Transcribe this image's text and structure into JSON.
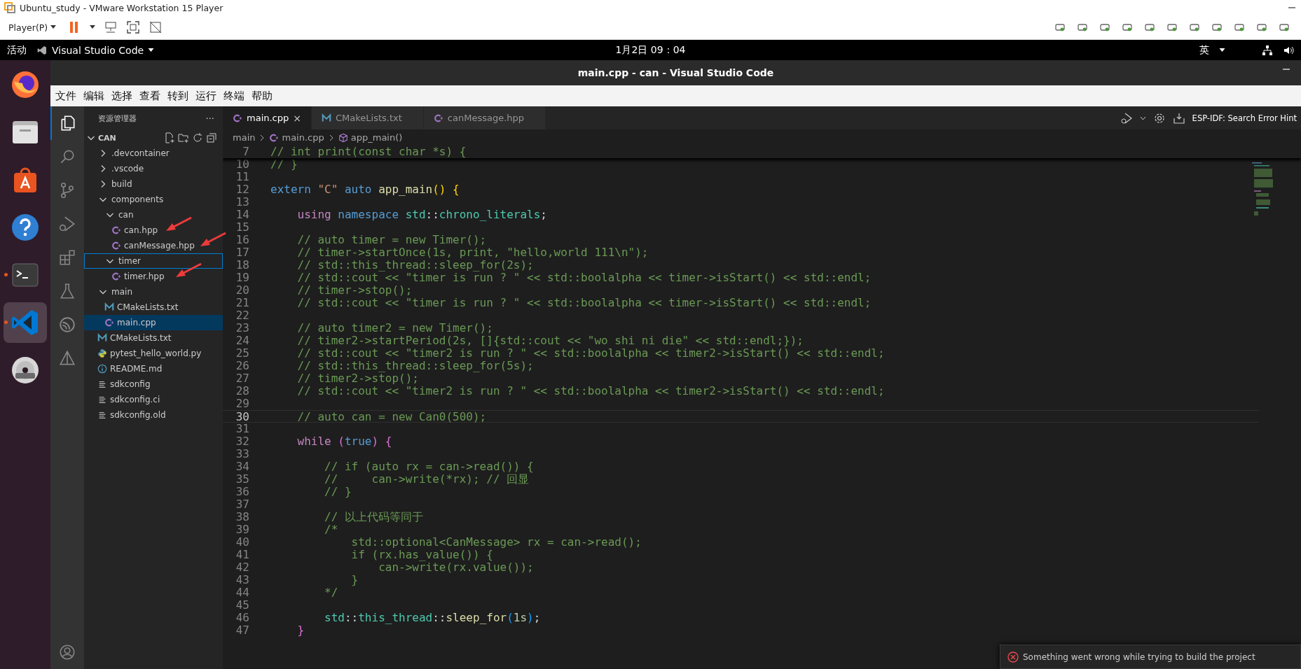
{
  "vm_window": {
    "title": "Ubuntu_study - VMware Workstation 15 Player",
    "player_menu": "Player(P)"
  },
  "top_bar": {
    "activities": "活动",
    "app_menu": "Visual Studio Code",
    "clock": "1月2日  09：04",
    "input_method": "英"
  },
  "dock": [
    {
      "kind": "firefox",
      "running": false,
      "selected": false
    },
    {
      "kind": "files",
      "running": false,
      "selected": false
    },
    {
      "kind": "store",
      "running": false,
      "selected": false
    },
    {
      "kind": "help",
      "running": false,
      "selected": false
    },
    {
      "kind": "terminal",
      "running": true,
      "selected": false
    },
    {
      "kind": "vscode",
      "running": true,
      "selected": true
    },
    {
      "kind": "dvd",
      "running": false,
      "selected": false
    }
  ],
  "window": {
    "title": "main.cpp - can - Visual Studio Code"
  },
  "menu": [
    "文件",
    "编辑",
    "选择",
    "查看",
    "转到",
    "运行",
    "终端",
    "帮助"
  ],
  "sidebar": {
    "title": "资源管理器",
    "more": "···",
    "root": {
      "label": "CAN",
      "expanded": true
    },
    "items": [
      {
        "label": ".devcontainer",
        "kind": "folder",
        "expanded": false,
        "selected": false,
        "focused": false,
        "annotated": false
      },
      {
        "label": ".vscode",
        "kind": "folder",
        "expanded": false,
        "selected": false,
        "focused": false,
        "annotated": false
      },
      {
        "label": "build",
        "kind": "folder",
        "expanded": false,
        "selected": false,
        "focused": false,
        "annotated": false
      },
      {
        "label": "components",
        "kind": "folder",
        "expanded": true,
        "selected": false,
        "focused": false,
        "annotated": false,
        "children": [
          {
            "label": "can",
            "kind": "folder",
            "expanded": true,
            "selected": false,
            "focused": false,
            "annotated": false,
            "children": [
              {
                "label": "can.hpp",
                "kind": "cpp",
                "selected": false,
                "focused": false,
                "annotated": true
              },
              {
                "label": "canMessage.hpp",
                "kind": "cpp",
                "selected": false,
                "focused": false,
                "annotated": true
              }
            ]
          },
          {
            "label": "timer",
            "kind": "folder",
            "expanded": true,
            "selected": false,
            "focused": true,
            "annotated": false,
            "children": [
              {
                "label": "timer.hpp",
                "kind": "cpp",
                "selected": false,
                "focused": false,
                "annotated": true
              }
            ]
          }
        ]
      },
      {
        "label": "main",
        "kind": "folder",
        "expanded": true,
        "selected": false,
        "focused": false,
        "annotated": false,
        "children": [
          {
            "label": "CMakeLists.txt",
            "kind": "cmake",
            "selected": false,
            "focused": false,
            "annotated": false
          },
          {
            "label": "main.cpp",
            "kind": "cpp",
            "selected": true,
            "focused": false,
            "annotated": false
          }
        ]
      },
      {
        "label": "CMakeLists.txt",
        "kind": "cmake",
        "selected": false,
        "focused": false,
        "annotated": false
      },
      {
        "label": "pytest_hello_world.py",
        "kind": "python",
        "selected": false,
        "focused": false,
        "annotated": false
      },
      {
        "label": "README.md",
        "kind": "info",
        "selected": false,
        "focused": false,
        "annotated": false
      },
      {
        "label": "sdkconfig",
        "kind": "config",
        "selected": false,
        "focused": false,
        "annotated": false
      },
      {
        "label": "sdkconfig.ci",
        "kind": "config",
        "selected": false,
        "focused": false,
        "annotated": false
      },
      {
        "label": "sdkconfig.old",
        "kind": "config",
        "selected": false,
        "focused": false,
        "annotated": false
      }
    ]
  },
  "tabs": [
    {
      "label": "main.cpp",
      "kind": "cpp",
      "selected": true,
      "close": "×"
    },
    {
      "label": "CMakeLists.txt",
      "kind": "cmake",
      "selected": false
    },
    {
      "label": "canMessage.hpp",
      "kind": "cpp",
      "selected": false
    }
  ],
  "editor_actions": {
    "hint": "ESP-IDF: Search Error Hint"
  },
  "breadcrumbs": [
    {
      "label": "main",
      "kind": "folder"
    },
    {
      "label": "main.cpp",
      "kind": "cpp"
    },
    {
      "label": "app_main()",
      "kind": "function"
    }
  ],
  "sticky_line": {
    "number": "7",
    "tokens": [
      {
        "text": "// int print(const char *s) {",
        "kind": "comment"
      }
    ]
  },
  "lines": [
    {
      "number": "10",
      "current": false,
      "tokens": [
        {
          "text": "// }",
          "kind": "comment"
        }
      ]
    },
    {
      "number": "11",
      "current": false
    },
    {
      "number": "12",
      "current": false,
      "tokens": [
        {
          "text": "extern",
          "kind": "keyword"
        },
        {
          "text": " \"C\"",
          "kind": "string"
        },
        {
          "text": " auto",
          "kind": "keyword"
        },
        {
          "text": " app_main",
          "kind": "func"
        },
        {
          "text": "()",
          "kind": "b1"
        },
        {
          "text": " {",
          "kind": "b1"
        }
      ]
    },
    {
      "number": "13",
      "current": false
    },
    {
      "number": "14",
      "current": false,
      "tokens": [
        {
          "text": "    using",
          "kind": "control"
        },
        {
          "text": " namespace",
          "kind": "keyword"
        },
        {
          "text": " std",
          "kind": "type"
        },
        {
          "text": "::",
          "kind": "plain"
        },
        {
          "text": "chrono_literals",
          "kind": "type"
        },
        {
          "text": ";",
          "kind": "plain"
        }
      ]
    },
    {
      "number": "15",
      "current": false
    },
    {
      "number": "16",
      "current": false,
      "tokens": [
        {
          "text": "    // auto timer = new Timer();",
          "kind": "comment"
        }
      ]
    },
    {
      "number": "17",
      "current": false,
      "tokens": [
        {
          "text": "    // timer->startOnce(1s, print, \"hello,world 111\\n\");",
          "kind": "comment"
        }
      ]
    },
    {
      "number": "18",
      "current": false,
      "tokens": [
        {
          "text": "    // std::this_thread::sleep_for(2s);",
          "kind": "comment"
        }
      ]
    },
    {
      "number": "19",
      "current": false,
      "tokens": [
        {
          "text": "    // std::cout << \"timer is run ? \" << std::boolalpha << timer->isStart() << std::endl;",
          "kind": "comment"
        }
      ]
    },
    {
      "number": "20",
      "current": false,
      "tokens": [
        {
          "text": "    // timer->stop();",
          "kind": "comment"
        }
      ]
    },
    {
      "number": "21",
      "current": false,
      "tokens": [
        {
          "text": "    // std::cout << \"timer is run ? \" << std::boolalpha << timer->isStart() << std::endl;",
          "kind": "comment"
        }
      ]
    },
    {
      "number": "22",
      "current": false
    },
    {
      "number": "23",
      "current": false,
      "tokens": [
        {
          "text": "    // auto timer2 = new Timer();",
          "kind": "comment"
        }
      ]
    },
    {
      "number": "24",
      "current": false,
      "tokens": [
        {
          "text": "    // timer2->startPeriod(2s, []{std::cout << \"wo shi ni die\" << std::endl;});",
          "kind": "comment"
        }
      ]
    },
    {
      "number": "25",
      "current": false,
      "tokens": [
        {
          "text": "    // std::cout << \"timer2 is run ? \" << std::boolalpha << timer2->isStart() << std::endl;",
          "kind": "comment"
        }
      ]
    },
    {
      "number": "26",
      "current": false,
      "tokens": [
        {
          "text": "    // std::this_thread::sleep_for(5s);",
          "kind": "comment"
        }
      ]
    },
    {
      "number": "27",
      "current": false,
      "tokens": [
        {
          "text": "    // timer2->stop();",
          "kind": "comment"
        }
      ]
    },
    {
      "number": "28",
      "current": false,
      "tokens": [
        {
          "text": "    // std::cout << \"timer2 is run ? \" << std::boolalpha << timer2->isStart() << std::endl;",
          "kind": "comment"
        }
      ]
    },
    {
      "number": "29",
      "current": false
    },
    {
      "number": "30",
      "current": true,
      "tokens": [
        {
          "text": "    // auto can = new Can0(500);",
          "kind": "comment"
        }
      ]
    },
    {
      "number": "31",
      "current": false
    },
    {
      "number": "32",
      "current": false,
      "tokens": [
        {
          "text": "    while",
          "kind": "control"
        },
        {
          "text": " (",
          "kind": "b2"
        },
        {
          "text": "true",
          "kind": "keyword"
        },
        {
          "text": ")",
          "kind": "b2"
        },
        {
          "text": " {",
          "kind": "b2"
        }
      ]
    },
    {
      "number": "33",
      "current": false
    },
    {
      "number": "34",
      "current": false,
      "tokens": [
        {
          "text": "        // if (auto rx = can->read()) {",
          "kind": "comment"
        }
      ]
    },
    {
      "number": "35",
      "current": false,
      "tokens": [
        {
          "text": "        //     can->write(*rx); // 回显",
          "kind": "comment"
        }
      ]
    },
    {
      "number": "36",
      "current": false,
      "tokens": [
        {
          "text": "        // }",
          "kind": "comment"
        }
      ]
    },
    {
      "number": "37",
      "current": false
    },
    {
      "number": "38",
      "current": false,
      "tokens": [
        {
          "text": "        // 以上代码等同于",
          "kind": "comment"
        }
      ]
    },
    {
      "number": "39",
      "current": false,
      "tokens": [
        {
          "text": "        /*",
          "kind": "comment"
        }
      ]
    },
    {
      "number": "40",
      "current": false,
      "tokens": [
        {
          "text": "            std::optional<CanMessage> rx = can->read();",
          "kind": "comment"
        }
      ]
    },
    {
      "number": "41",
      "current": false,
      "tokens": [
        {
          "text": "            if (rx.has_value()) {",
          "kind": "comment"
        }
      ]
    },
    {
      "number": "42",
      "current": false,
      "tokens": [
        {
          "text": "                can->write(rx.value());",
          "kind": "comment"
        }
      ]
    },
    {
      "number": "43",
      "current": false,
      "tokens": [
        {
          "text": "            }",
          "kind": "comment"
        }
      ]
    },
    {
      "number": "44",
      "current": false,
      "tokens": [
        {
          "text": "        */",
          "kind": "comment"
        }
      ]
    },
    {
      "number": "45",
      "current": false
    },
    {
      "number": "46",
      "current": false,
      "tokens": [
        {
          "text": "        std",
          "kind": "type"
        },
        {
          "text": "::",
          "kind": "plain"
        },
        {
          "text": "this_thread",
          "kind": "type"
        },
        {
          "text": "::",
          "kind": "plain"
        },
        {
          "text": "sleep_for",
          "kind": "func"
        },
        {
          "text": "(",
          "kind": "b3"
        },
        {
          "text": "1s",
          "kind": "number"
        },
        {
          "text": ")",
          "kind": "b3"
        },
        {
          "text": ";",
          "kind": "plain"
        }
      ]
    },
    {
      "number": "47",
      "current": false,
      "tokens": [
        {
          "text": "    }",
          "kind": "b2"
        }
      ]
    }
  ],
  "notification": {
    "kind": "error",
    "message": "Something went wrong while trying to build the project"
  }
}
